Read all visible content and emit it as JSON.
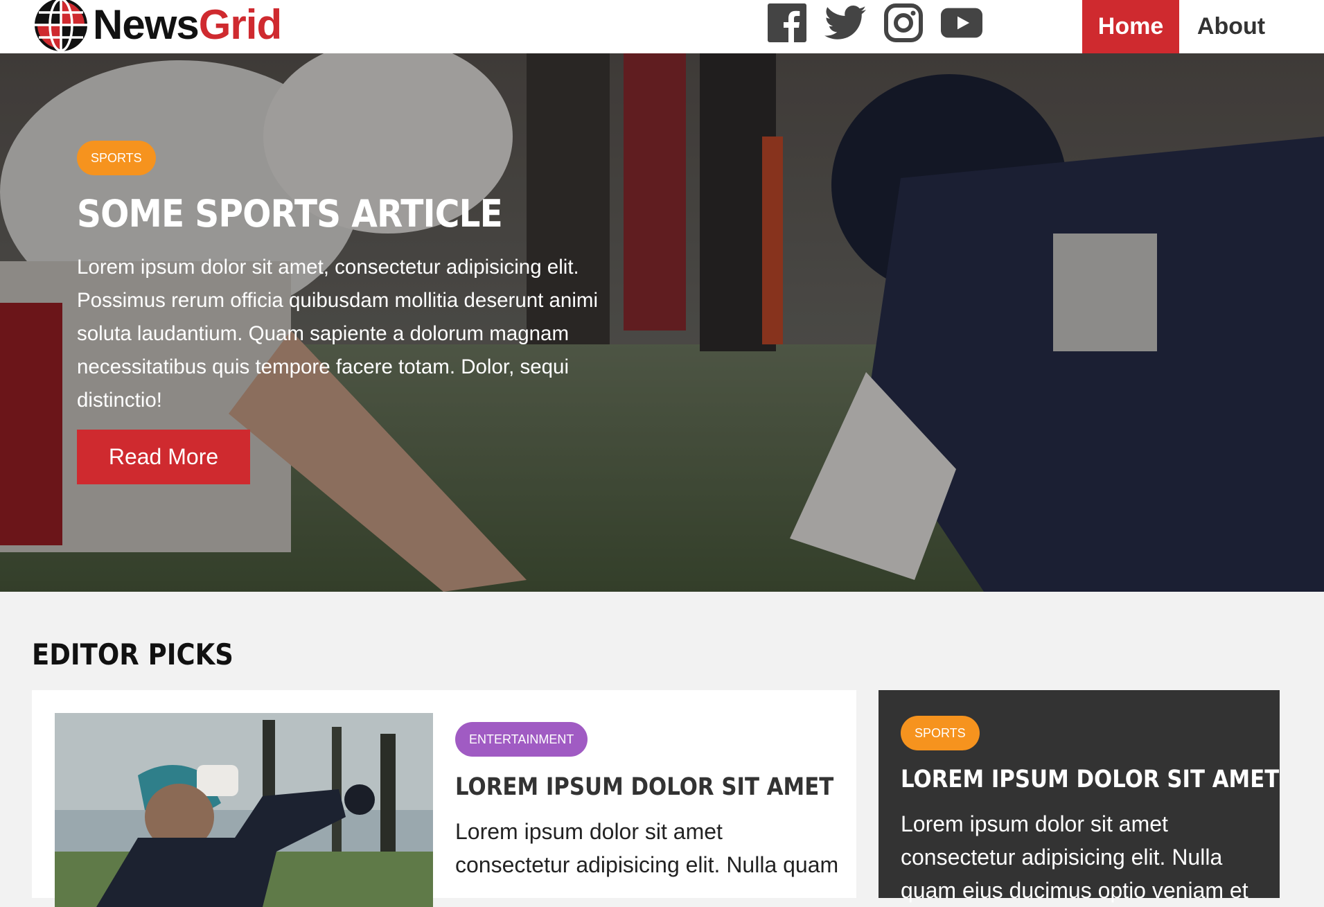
{
  "header": {
    "logo_part1": "News",
    "logo_part2": "Grid",
    "social_icons": [
      "facebook-icon",
      "twitter-icon",
      "instagram-icon",
      "youtube-icon"
    ],
    "nav": {
      "home": "Home",
      "about": "About"
    }
  },
  "hero": {
    "category": "SPORTS",
    "title": "Some Sports Article",
    "text": "Lorem ipsum dolor sit amet, consectetur adipisicing elit. Possimus rerum officia quibusdam mollitia deserunt animi soluta laudantium. Quam sapiente a dolorum magnam necessitatibus quis tempore facere totam. Dolor, sequi distinctio!",
    "button": "Read More"
  },
  "editor_picks": {
    "heading": "Editor Picks",
    "main_card": {
      "category": "ENTERTAINMENT",
      "title": "Lorem ipsum dolor sit amet",
      "text": "Lorem ipsum dolor sit amet consectetur adipisicing elit. Nulla quam"
    },
    "side_card": {
      "category": "SPORTS",
      "title": "Lorem ipsum dolor sit amet",
      "text": "Lorem ipsum dolor sit amet consectetur adipisicing elit. Nulla quam eius ducimus optio veniam et"
    }
  },
  "colors": {
    "brand_red": "#cf2a2f",
    "sports_orange": "#f6931e",
    "entertainment_purple": "#a05bc3",
    "dark_card": "#333333"
  }
}
